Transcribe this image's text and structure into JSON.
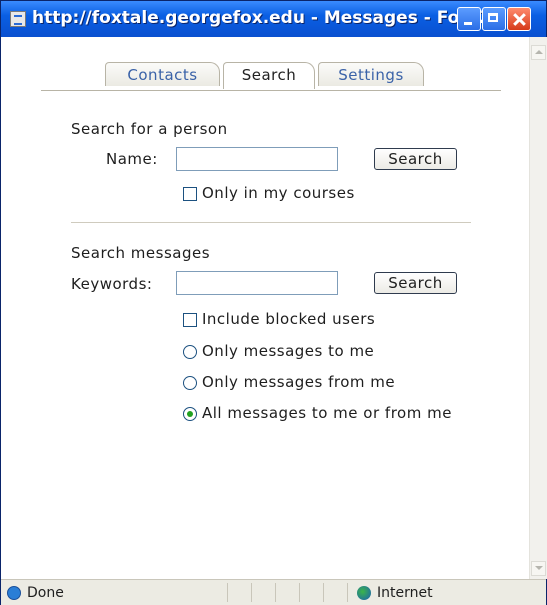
{
  "window": {
    "title": "http://foxtale.georgefox.edu - Messages - FoxT..."
  },
  "tabs": [
    {
      "label": "Contacts",
      "active": false
    },
    {
      "label": "Search",
      "active": true
    },
    {
      "label": "Settings",
      "active": false
    }
  ],
  "person_search": {
    "heading": "Search for a person",
    "name_label": "Name:",
    "name_value": "",
    "search_button": "Search",
    "only_my_courses_label": "Only in my courses",
    "only_my_courses_checked": false
  },
  "message_search": {
    "heading": "Search messages",
    "keywords_label": "Keywords:",
    "keywords_value": "",
    "search_button": "Search",
    "include_blocked_label": "Include blocked users",
    "include_blocked_checked": false,
    "options": [
      {
        "label": "Only messages to me",
        "selected": false
      },
      {
        "label": "Only messages from me",
        "selected": false
      },
      {
        "label": "All messages to me or from me",
        "selected": true
      }
    ]
  },
  "statusbar": {
    "status": "Done",
    "zone": "Internet"
  },
  "colors": {
    "titlebar": "#0a50d0",
    "tab_text": "#3a62a8",
    "radio_dot": "#21a121"
  }
}
